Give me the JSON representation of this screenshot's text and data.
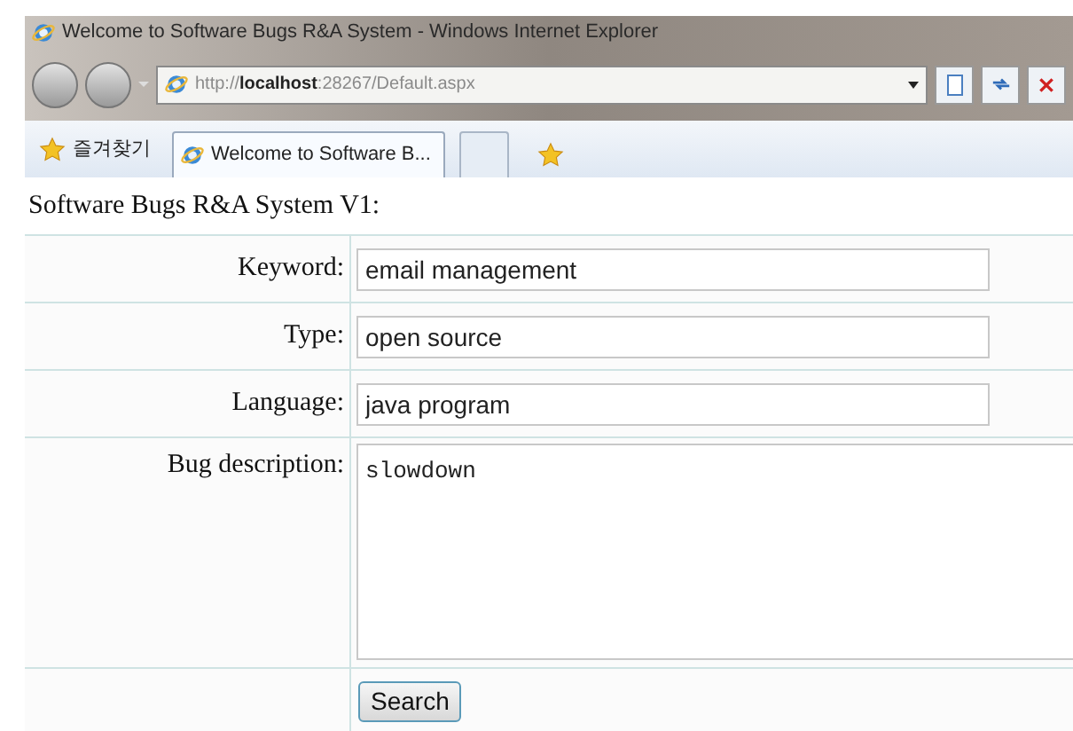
{
  "window": {
    "title": "Welcome to Software Bugs R&A System - Windows Internet Explorer"
  },
  "address_bar": {
    "url": "http://**localhost**:28267/Default.aspx"
  },
  "favorites": {
    "label": "즐겨찾기"
  },
  "tabs": [
    {
      "label": "Welcome to Software B...",
      "selected": true
    },
    {
      "selected": false
    }
  ],
  "page": {
    "heading": "Software Bugs R&A System V1:",
    "fields": [
      {
        "kind": "text",
        "label": "Keyword:",
        "value": "email management"
      },
      {
        "kind": "text",
        "label": "Type:",
        "value": "open source"
      },
      {
        "kind": "text",
        "label": "Language:",
        "value": "java program"
      },
      {
        "kind": "textarea",
        "label": "Bug description:",
        "value": "slowdown"
      }
    ],
    "button": "Search"
  }
}
